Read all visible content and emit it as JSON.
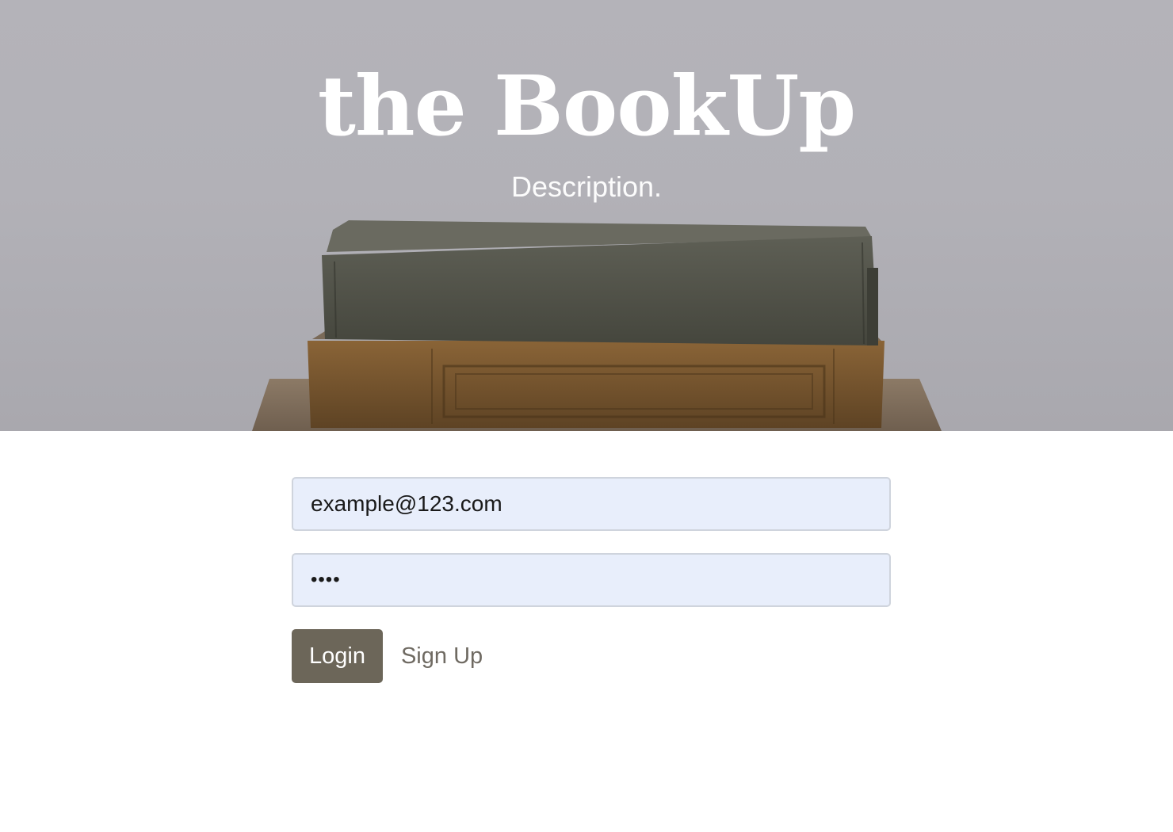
{
  "hero": {
    "title": "the BookUp",
    "description": "Description."
  },
  "login_form": {
    "email_value": "example@123.com",
    "password_value": "••••",
    "login_label": "Login",
    "signup_label": "Sign Up"
  },
  "colors": {
    "button_bg": "#6c6659",
    "input_bg": "#e8eefb",
    "hero_bg": "#b3b2b8"
  }
}
